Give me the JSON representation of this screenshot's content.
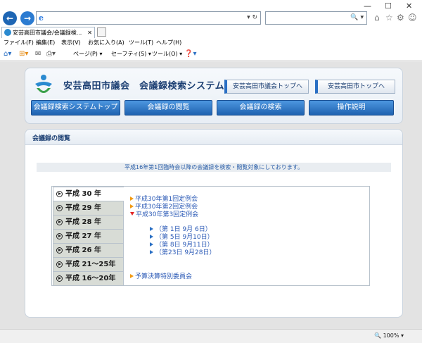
{
  "browser": {
    "address_value": "",
    "tab_title": "安芸高田市議会/会議録検...",
    "menu": [
      "ファイル(F)",
      "編集(E)",
      "表示(V)",
      "お気に入り(A)",
      "ツール(T)",
      "ヘルプ(H)"
    ],
    "commands": [
      "ページ(P) ▾",
      "セーフティ(S) ▾",
      "ツール(O) ▾"
    ],
    "address_controls": "▾ ↻",
    "search_controls": "🔍 ▾",
    "window_controls": [
      "—",
      "☐",
      "✕"
    ],
    "zoom": "100%"
  },
  "site": {
    "title": "安芸高田市議会　会議録検索システム",
    "top_links": [
      "安芸高田市議会トップへ",
      "安芸高田市トップへ"
    ],
    "nav": [
      "会議録検索システムトップ",
      "会議録の閲覧",
      "会議録の検索",
      "操作説明"
    ]
  },
  "content": {
    "heading": "会議録の閲覧",
    "notice": "平成16年第1回臨時会以降の会議録を検索・閲覧対象にしております。",
    "eras": [
      "平成 30 年",
      "平成 29 年",
      "平成 28 年",
      "平成 27 年",
      "平成 26 年",
      "平成 21～25年",
      "平成 16～20年"
    ],
    "sessions": [
      "平成30年第1回定例会",
      "平成30年第2回定例会",
      "平成30年第3回定例会"
    ],
    "days": [
      "（第 1日  9月 6日）",
      "（第 5日  9月10日）",
      "（第 8日  9月11日）",
      "（第23日  9月28日）"
    ],
    "committee": "予算決算特別委員会"
  },
  "colors": {
    "accent": "#2a6fc4",
    "nav_button": "#2d78c8",
    "link": "#2b5ab6"
  }
}
